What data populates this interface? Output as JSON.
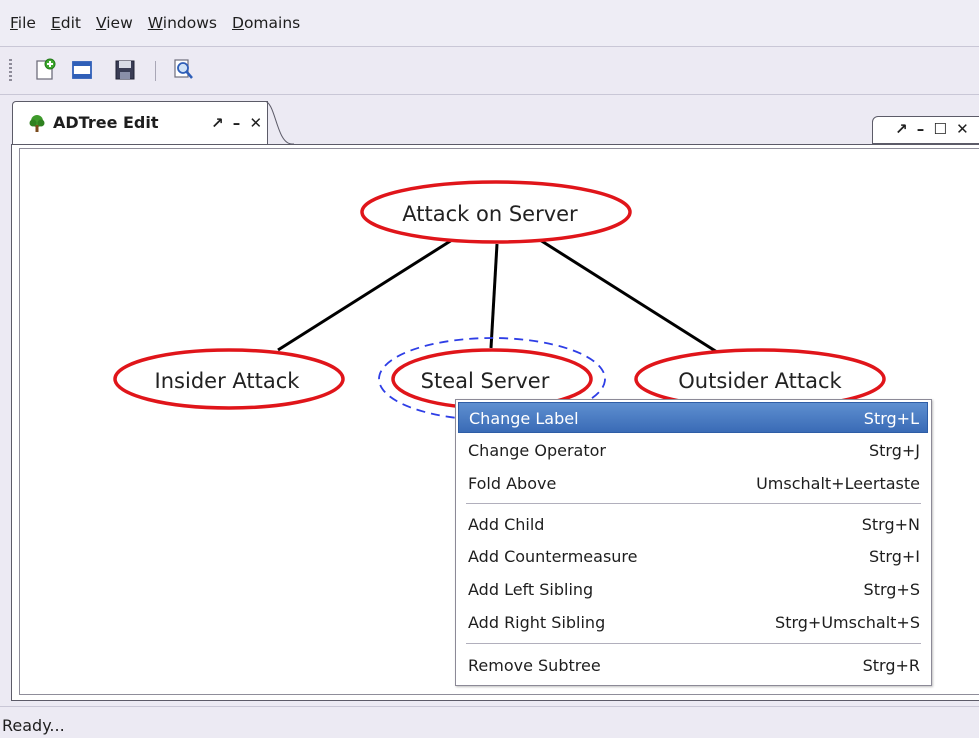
{
  "menubar": {
    "items": [
      {
        "mnemonic": "F",
        "rest": "ile"
      },
      {
        "mnemonic": "E",
        "rest": "dit"
      },
      {
        "mnemonic": "V",
        "rest": "iew"
      },
      {
        "mnemonic": "W",
        "rest": "indows"
      },
      {
        "mnemonic": "D",
        "rest": "omains"
      }
    ]
  },
  "toolbar": {
    "icons": [
      "new-document-icon",
      "open-icon",
      "save-icon",
      "zoom-icon"
    ]
  },
  "tab": {
    "title": "ADTree Edit",
    "controls": "↗ – ✕",
    "icon": "tree-icon"
  },
  "side_controls": "↗ – ☐ ✕",
  "tree": {
    "root": "Attack on Server",
    "children": [
      "Insider Attack",
      "Steal Server",
      "Outsider Attack"
    ],
    "selected": "Steal Server",
    "node_color": "#e0151a",
    "selection_color": "#2e3ee6"
  },
  "context_menu": {
    "items": [
      {
        "label": "Change Label",
        "shortcut": "Strg+L"
      },
      {
        "label": "Change Operator",
        "shortcut": "Strg+J"
      },
      {
        "label": "Fold Above",
        "shortcut": "Umschalt+Leertaste"
      },
      {
        "label": "Add Child",
        "shortcut": "Strg+N"
      },
      {
        "label": "Add Countermeasure",
        "shortcut": "Strg+I"
      },
      {
        "label": "Add Left Sibling",
        "shortcut": "Strg+S"
      },
      {
        "label": "Add Right Sibling",
        "shortcut": "Strg+Umschalt+S"
      },
      {
        "label": "Remove Subtree",
        "shortcut": "Strg+R"
      }
    ],
    "highlighted": "Change Label",
    "highlight_color": "#4b7cc4"
  },
  "status": {
    "text": "Ready..."
  }
}
